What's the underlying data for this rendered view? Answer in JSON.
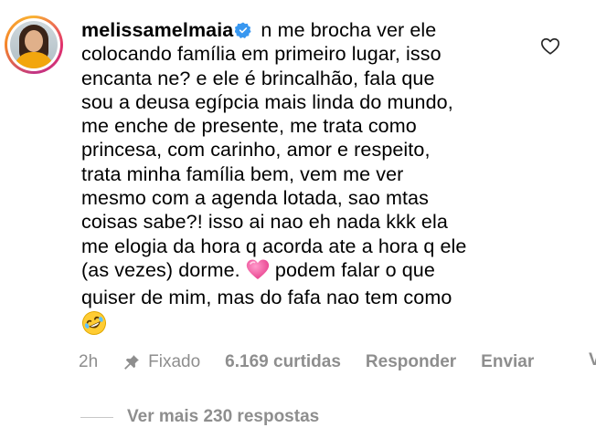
{
  "comment": {
    "username": "melissamelmaia",
    "text_part1": " n me brocha ver ele\ncolocando família em primeiro lugar, isso\nencanta ne? e ele é brincalhão, fala que\nsou a deusa egípcia mais linda do mundo,\nme enche de presente, me trata como\nprincesa, com carinho, amor e respeito,\ntrata minha família bem, vem me ver\nmesmo com a agenda lotada, sao mtas\ncoisas sabe?! isso ai nao eh nada kkk ela\nme elogia da hora q acorda ate a hora q ele\n(as vezes) dorme. ",
    "emoji_heart": "💗",
    "text_part2": " podem falar o que\nquiser de mim, mas do fafa nao tem como\n",
    "emoji_laugh": "🤣"
  },
  "actions": {
    "time": "2h",
    "pinned_label": "Fixado",
    "likes": "6.169 curtidas",
    "reply_label": "Responder",
    "send_label": "Enviar",
    "cut_text": "V"
  },
  "replies": {
    "view_more": "Ver mais 230 respostas"
  },
  "colors": {
    "text": "#000000",
    "meta": "#8e8e8e",
    "verified": "#3897f0"
  }
}
